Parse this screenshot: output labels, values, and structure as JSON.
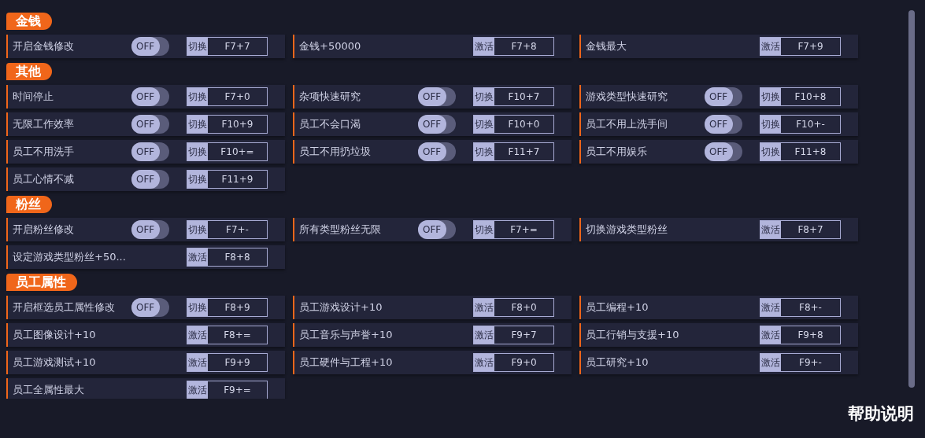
{
  "sections": [
    {
      "title": "金钱",
      "items": [
        {
          "kind": "toggle",
          "label": "开启金钱修改",
          "on": false,
          "switch_text": "OFF",
          "action": "切换",
          "hotkey": "F7+7"
        },
        {
          "kind": "action",
          "label": "金钱+50000",
          "action": "激活",
          "hotkey": "F7+8"
        },
        {
          "kind": "action",
          "label": "金钱最大",
          "action": "激活",
          "hotkey": "F7+9"
        }
      ]
    },
    {
      "title": "其他",
      "items": [
        {
          "kind": "toggle",
          "label": "时间停止",
          "on": false,
          "switch_text": "OFF",
          "action": "切换",
          "hotkey": "F7+0"
        },
        {
          "kind": "toggle",
          "label": "杂项快速研究",
          "on": false,
          "switch_text": "OFF",
          "action": "切换",
          "hotkey": "F10+7"
        },
        {
          "kind": "toggle",
          "label": "游戏类型快速研究",
          "on": false,
          "switch_text": "OFF",
          "action": "切换",
          "hotkey": "F10+8"
        },
        {
          "kind": "toggle",
          "label": "无限工作效率",
          "on": false,
          "switch_text": "OFF",
          "action": "切换",
          "hotkey": "F10+9"
        },
        {
          "kind": "toggle",
          "label": "员工不会口渴",
          "on": false,
          "switch_text": "OFF",
          "action": "切换",
          "hotkey": "F10+0"
        },
        {
          "kind": "toggle",
          "label": "员工不用上洗手间",
          "on": false,
          "switch_text": "OFF",
          "action": "切换",
          "hotkey": "F10+-"
        },
        {
          "kind": "toggle",
          "label": "员工不用洗手",
          "on": false,
          "switch_text": "OFF",
          "action": "切换",
          "hotkey": "F10+="
        },
        {
          "kind": "toggle",
          "label": "员工不用扔垃圾",
          "on": false,
          "switch_text": "OFF",
          "action": "切换",
          "hotkey": "F11+7"
        },
        {
          "kind": "toggle",
          "label": "员工不用娱乐",
          "on": false,
          "switch_text": "OFF",
          "action": "切换",
          "hotkey": "F11+8"
        },
        {
          "kind": "toggle",
          "label": "员工心情不减",
          "on": false,
          "switch_text": "OFF",
          "action": "切换",
          "hotkey": "F11+9"
        }
      ]
    },
    {
      "title": "粉丝",
      "items": [
        {
          "kind": "toggle",
          "label": "开启粉丝修改",
          "on": false,
          "switch_text": "OFF",
          "action": "切换",
          "hotkey": "F7+-"
        },
        {
          "kind": "toggle",
          "label": "所有类型粉丝无限",
          "on": false,
          "switch_text": "OFF",
          "action": "切换",
          "hotkey": "F7+="
        },
        {
          "kind": "action",
          "label": "切换游戏类型粉丝",
          "action": "激活",
          "hotkey": "F8+7"
        },
        {
          "kind": "action",
          "label": "设定游戏类型粉丝+50...",
          "action": "激活",
          "hotkey": "F8+8"
        }
      ]
    },
    {
      "title": "员工属性",
      "items": [
        {
          "kind": "toggle",
          "label": "开启框选员工属性修改",
          "on": false,
          "switch_text": "OFF",
          "action": "切换",
          "hotkey": "F8+9"
        },
        {
          "kind": "action",
          "label": "员工游戏设计+10",
          "action": "激活",
          "hotkey": "F8+0"
        },
        {
          "kind": "action",
          "label": "员工编程+10",
          "action": "激活",
          "hotkey": "F8+-"
        },
        {
          "kind": "action",
          "label": "员工图像设计+10",
          "action": "激活",
          "hotkey": "F8+="
        },
        {
          "kind": "action",
          "label": "员工音乐与声誉+10",
          "action": "激活",
          "hotkey": "F9+7"
        },
        {
          "kind": "action",
          "label": "员工行销与支援+10",
          "action": "激活",
          "hotkey": "F9+8"
        },
        {
          "kind": "action",
          "label": "员工游戏测试+10",
          "action": "激活",
          "hotkey": "F9+9"
        },
        {
          "kind": "action",
          "label": "员工硬件与工程+10",
          "action": "激活",
          "hotkey": "F9+0"
        },
        {
          "kind": "action",
          "label": "员工研究+10",
          "action": "激活",
          "hotkey": "F9+-"
        },
        {
          "kind": "action",
          "label": "员工全属性最大",
          "action": "激活",
          "hotkey": "F9+="
        }
      ]
    }
  ],
  "help_link": "帮助说明"
}
